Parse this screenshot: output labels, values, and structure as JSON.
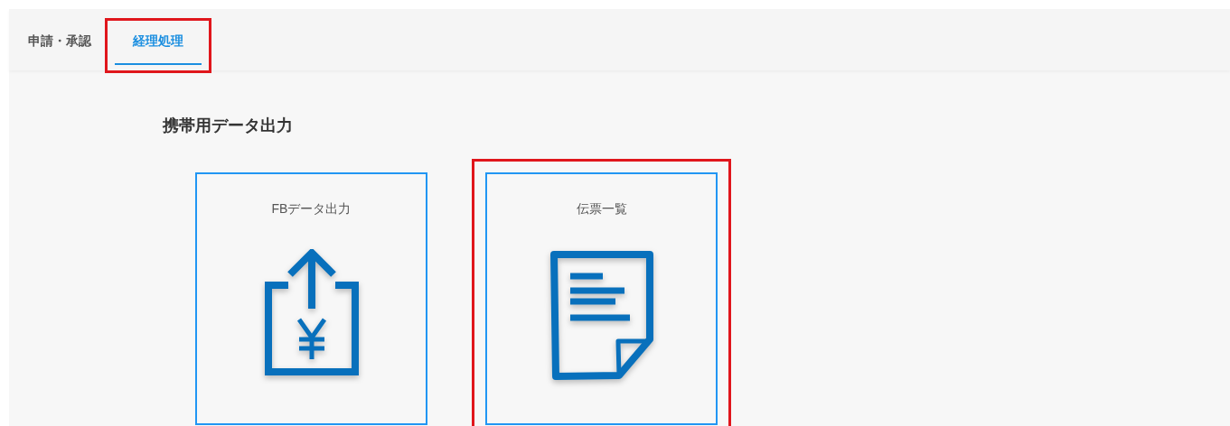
{
  "tabs": [
    {
      "label": "申請・承認",
      "selected": false,
      "highlighted": false
    },
    {
      "label": "経理処理",
      "selected": true,
      "highlighted": true
    }
  ],
  "section": {
    "title": "携帯用データ出力"
  },
  "cards": [
    {
      "label": "FBデータ出力",
      "kind": "export",
      "highlighted": false
    },
    {
      "label": "伝票一覧",
      "kind": "document",
      "highlighted": true
    }
  ]
}
